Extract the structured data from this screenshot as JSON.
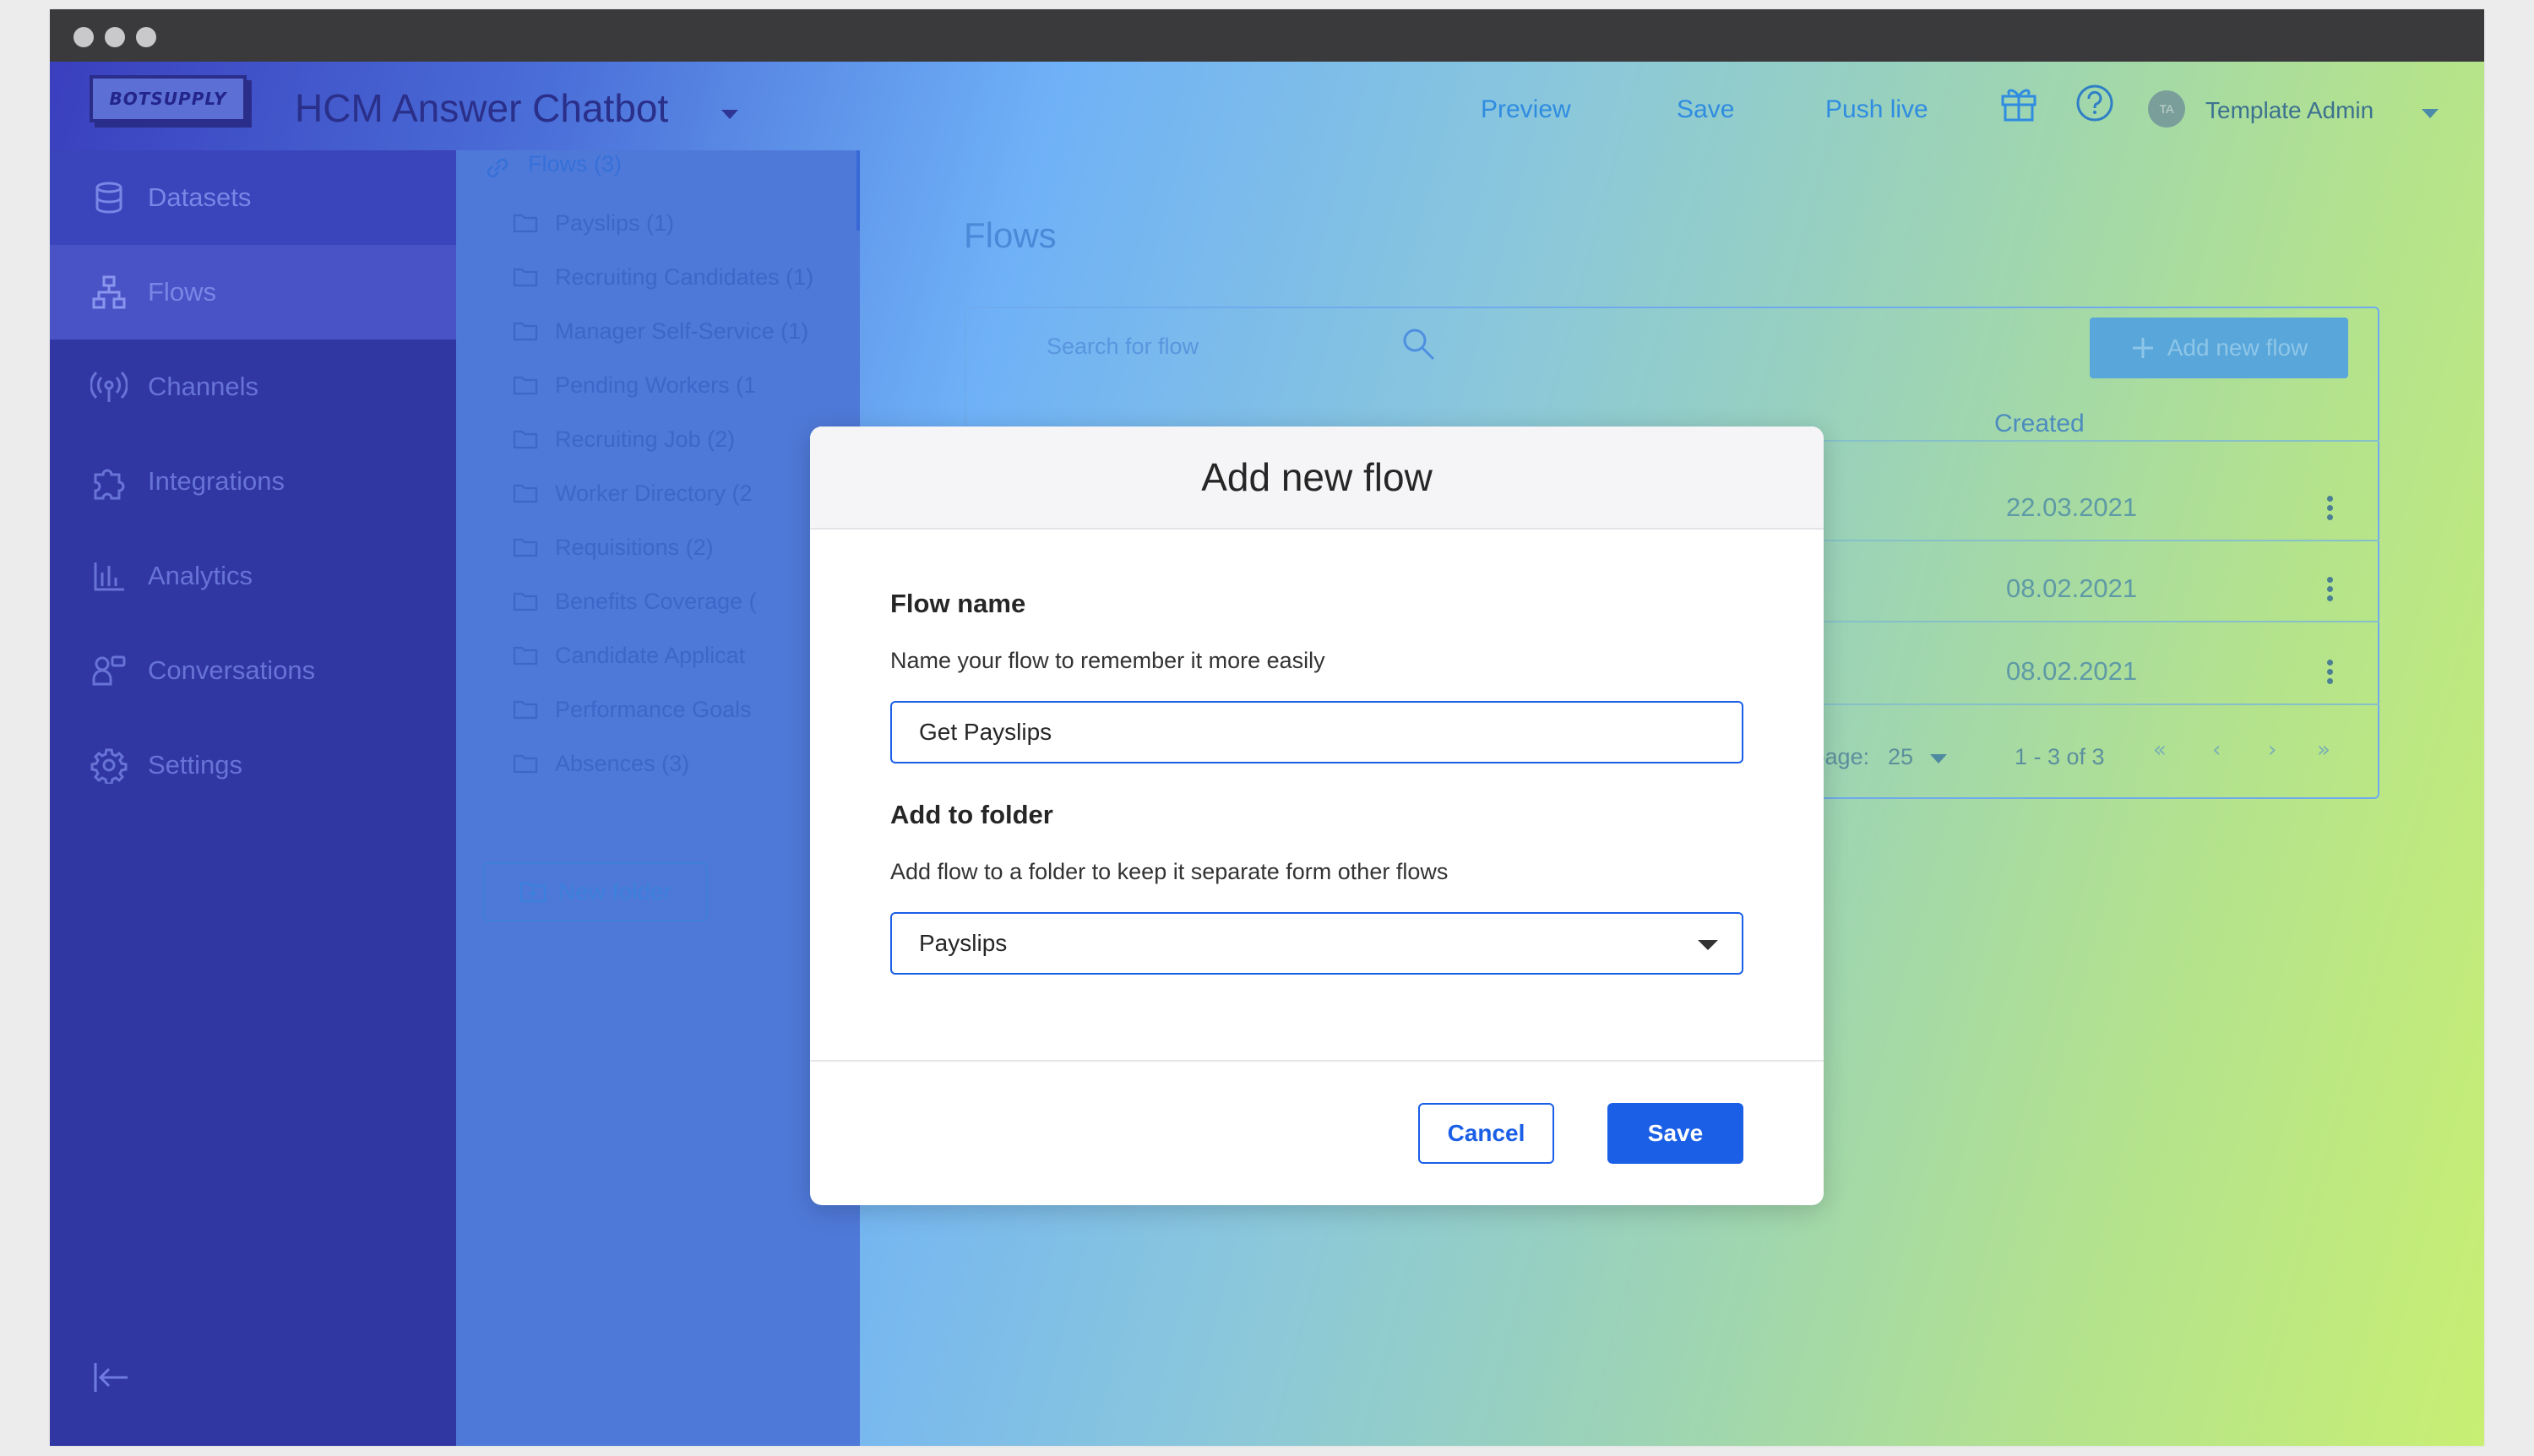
{
  "app": {
    "logo_text": "BOTSUPPLY",
    "title": "HCM Answer Chatbot",
    "actions": [
      "Preview",
      "Save",
      "Push live"
    ],
    "user_initials": "TA",
    "user_name": "Template Admin"
  },
  "sidebar": {
    "items": [
      {
        "label": "Datasets",
        "icon": "database-icon"
      },
      {
        "label": "Flows",
        "icon": "flows-icon",
        "active": true
      },
      {
        "label": "Channels",
        "icon": "broadcast-icon"
      },
      {
        "label": "Integrations",
        "icon": "puzzle-icon"
      },
      {
        "label": "Analytics",
        "icon": "bar-chart-icon"
      },
      {
        "label": "Conversations",
        "icon": "conversations-icon"
      },
      {
        "label": "Settings",
        "icon": "gear-icon"
      }
    ]
  },
  "folders": {
    "header": "Flows (3)",
    "items": [
      "Payslips (1)",
      "Recruiting Candidates (1)",
      "Manager Self-Service (1)",
      "Pending Workers (1",
      "Recruiting Job (2)",
      "Worker Directory (2",
      "Requisitions (2)",
      "Benefits Coverage (",
      "Candidate Applicat",
      "Performance Goals",
      "Absences (3)"
    ],
    "new_folder_label": "New folder"
  },
  "main": {
    "title": "Flows",
    "search_placeholder": "Search for flow",
    "add_flow_label": "Add new flow",
    "column_created": "Created",
    "rows": [
      {
        "created": "22.03.2021"
      },
      {
        "created": "08.02.2021"
      },
      {
        "created": "08.02.2021"
      }
    ],
    "per_page_label": "per page:",
    "per_page_value": "25",
    "range": "1 - 3 of 3"
  },
  "modal": {
    "title": "Add new flow",
    "flow_name_label": "Flow name",
    "flow_name_help": "Name your flow to remember it more easily",
    "flow_name_value": "Get Payslips",
    "folder_label": "Add to folder",
    "folder_help": "Add flow to a folder to keep it separate form other flows",
    "folder_value": "Payslips",
    "cancel_label": "Cancel",
    "save_label": "Save"
  },
  "colors": {
    "primary": "#1a5fe6",
    "sidebar": "#3037a3"
  }
}
